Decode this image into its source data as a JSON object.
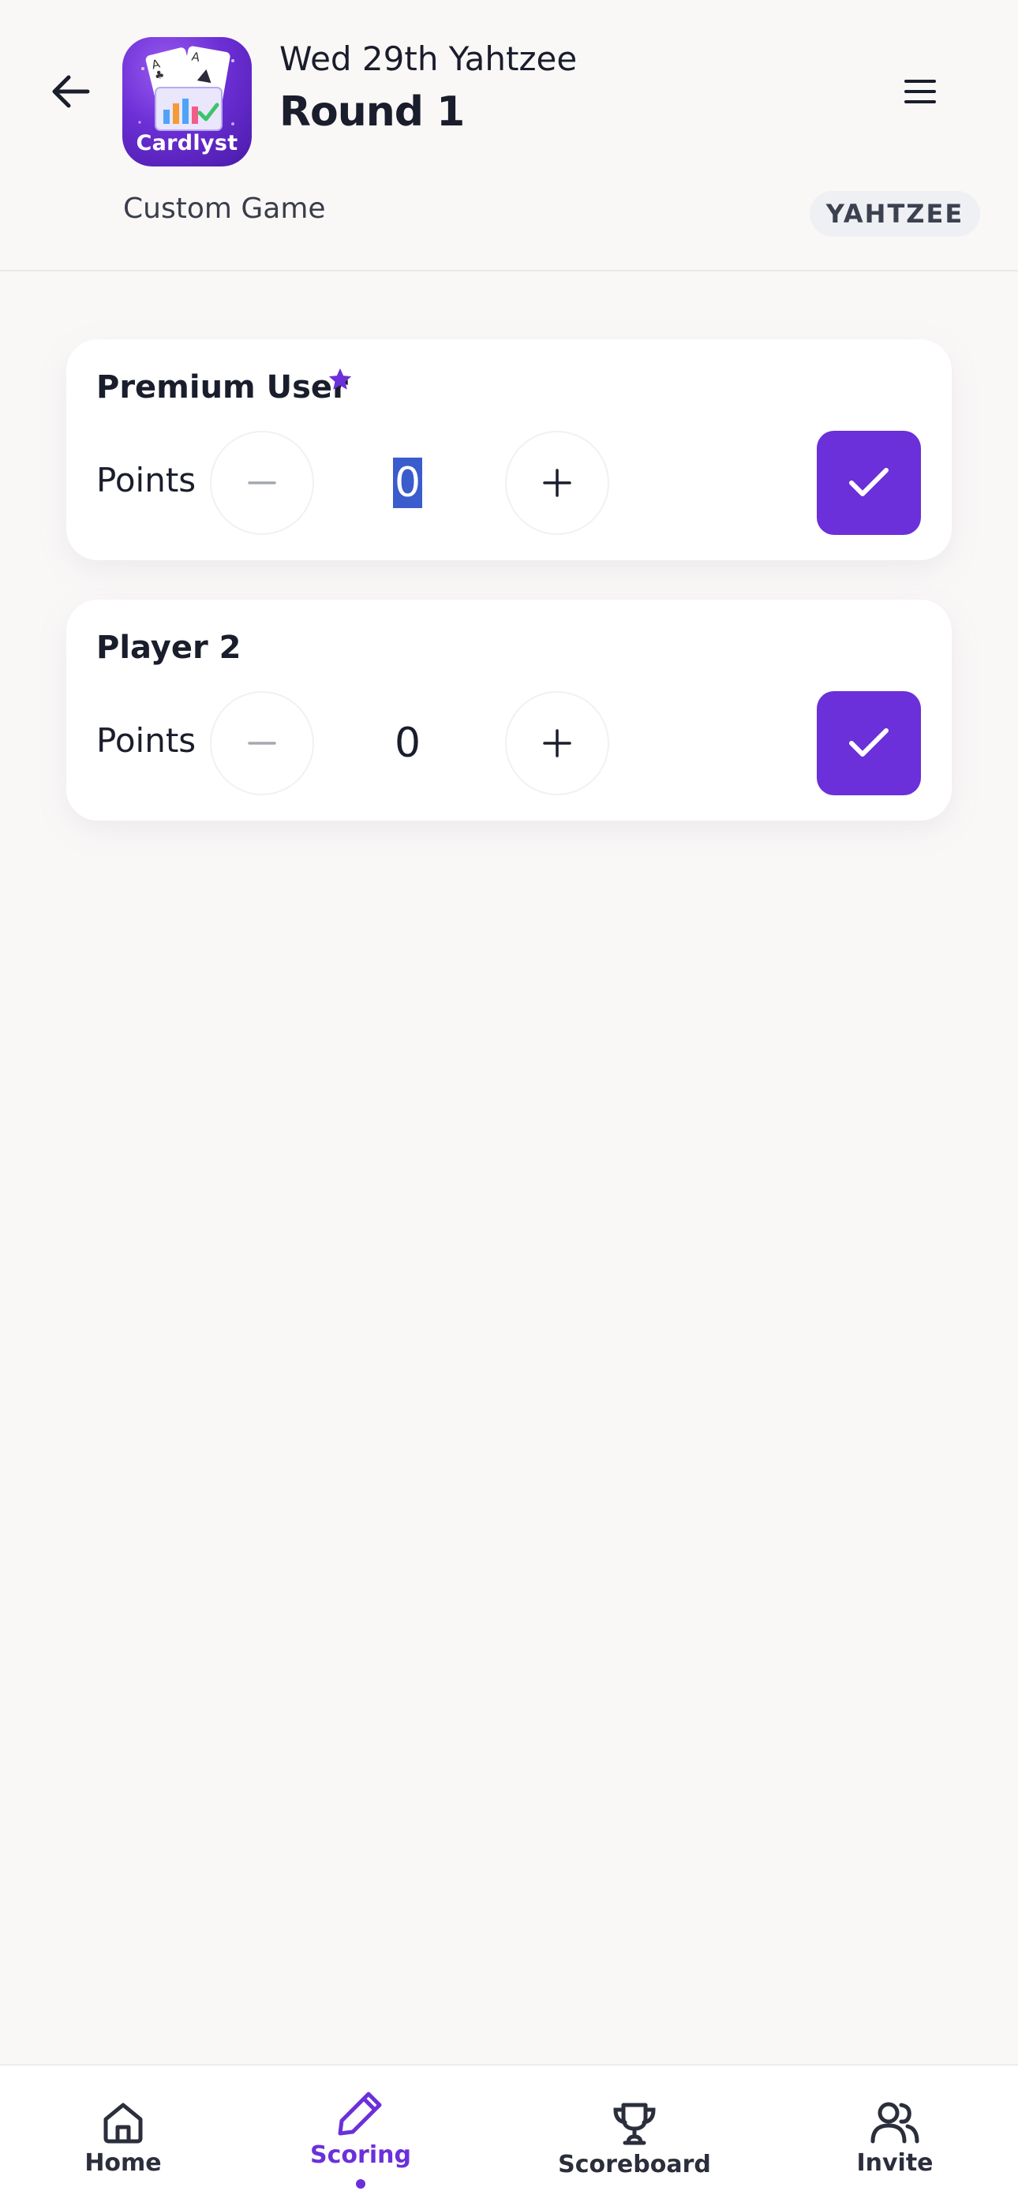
{
  "header": {
    "title": "Wed 29th Yahtzee",
    "round": "Round 1",
    "subtitle": "Custom Game",
    "game_tag": "YAHTZEE",
    "logo_text": "Cardlyst"
  },
  "icons": {
    "back": "arrow-left-icon",
    "menu": "hamburger-menu-icon",
    "premium": "star-icon",
    "minus": "minus-icon",
    "plus": "plus-icon",
    "confirm": "checkmark-icon"
  },
  "players": [
    {
      "name": "Premium User",
      "premium": true,
      "points_label": "Points",
      "score": "0",
      "score_selected": true
    },
    {
      "name": "Player 2",
      "premium": false,
      "points_label": "Points",
      "score": "0",
      "score_selected": false
    }
  ],
  "nav": {
    "items": [
      {
        "label": "Home",
        "icon": "home-icon",
        "active": false
      },
      {
        "label": "Scoring",
        "icon": "pencil-icon",
        "active": true
      },
      {
        "label": "Scoreboard",
        "icon": "trophy-icon",
        "active": false
      },
      {
        "label": "Invite",
        "icon": "users-icon",
        "active": false
      }
    ]
  },
  "colors": {
    "accent": "#6b30d9",
    "background": "#faf8f7",
    "card": "#ffffff",
    "text": "#1a1d2b",
    "selection": "#3a5ccc"
  }
}
